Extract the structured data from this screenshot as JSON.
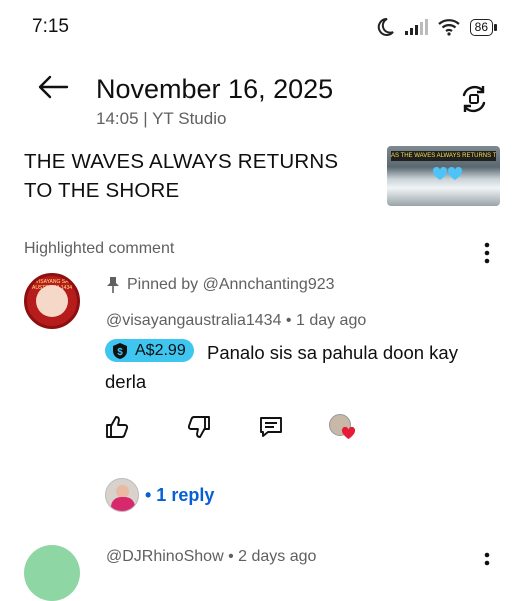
{
  "status_bar": {
    "time": "7:15",
    "battery": "86"
  },
  "header": {
    "title": "November 16, 2025",
    "subtitle": "14:05 | YT Studio"
  },
  "video": {
    "title": "THE WAVES ALWAYS RETURNS TO THE SHORE",
    "thumbnail_caption": "AS THE WAVES ALWAYS RETURNS TO THE SHORE"
  },
  "highlighted": {
    "label": "Highlighted comment",
    "avatar_text": "VISAYANG SA AUSTRALIA 1434",
    "pinned_by": "Pinned by @Annchanting923",
    "author": "@visayangaustralia1434",
    "time_ago": "1 day ago",
    "super_chat_amount": "A$2.99",
    "text": "Panalo sis sa pahula doon kay derla",
    "reply_link": "• 1 reply"
  },
  "next_comment": {
    "meta": "@DJRhinoShow • 2 days ago"
  },
  "colors": {
    "chip": "#3ec6f0",
    "link": "#065fd4",
    "secondary_text": "#606060",
    "heart": "#e51b38"
  }
}
